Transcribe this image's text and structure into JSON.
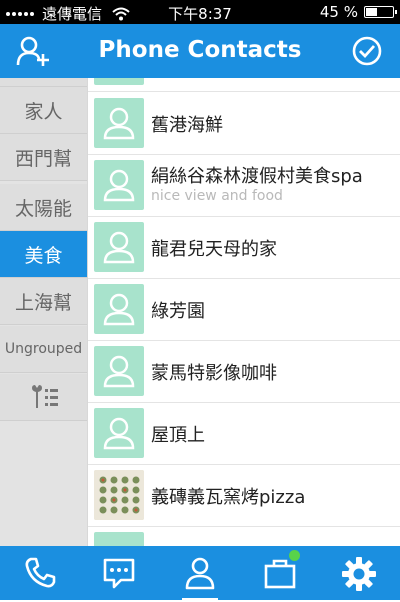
{
  "status_bar": {
    "carrier": "遠傳電信",
    "time": "下午8:37",
    "battery_text": "45 %",
    "battery_level": 0.45
  },
  "nav": {
    "title": "Phone Contacts",
    "left_icon": "add-contact-icon",
    "right_icon": "checkmark-circle-icon"
  },
  "sidebar": {
    "items": [
      {
        "label": "家人"
      },
      {
        "label": "西門幫"
      },
      {
        "label": "太陽能"
      },
      {
        "label": "美食",
        "active": true
      },
      {
        "label": "上海幫"
      },
      {
        "label": "Ungrouped"
      }
    ],
    "settings_icon": "group-settings-icon"
  },
  "contacts": [
    {
      "name": "舊港海鮮"
    },
    {
      "name": "絹絲谷森林渡假村美食spa",
      "note": "nice view and food"
    },
    {
      "name": "龍君兒天母的家"
    },
    {
      "name": "綠芳園"
    },
    {
      "name": "蒙馬特影像咖啡"
    },
    {
      "name": "屋頂上"
    },
    {
      "name": "義磚義瓦窯烤pizza",
      "has_photo": true
    }
  ],
  "tab_bar": {
    "tabs": [
      {
        "icon": "phone-icon"
      },
      {
        "icon": "message-icon"
      },
      {
        "icon": "contacts-icon",
        "active": true
      },
      {
        "icon": "briefcase-icon",
        "badge": true
      },
      {
        "icon": "settings-gear-icon"
      }
    ]
  },
  "colors": {
    "accent": "#1b8fe0",
    "avatar_bg": "#a8e3cc",
    "badge": "#58d34a"
  }
}
